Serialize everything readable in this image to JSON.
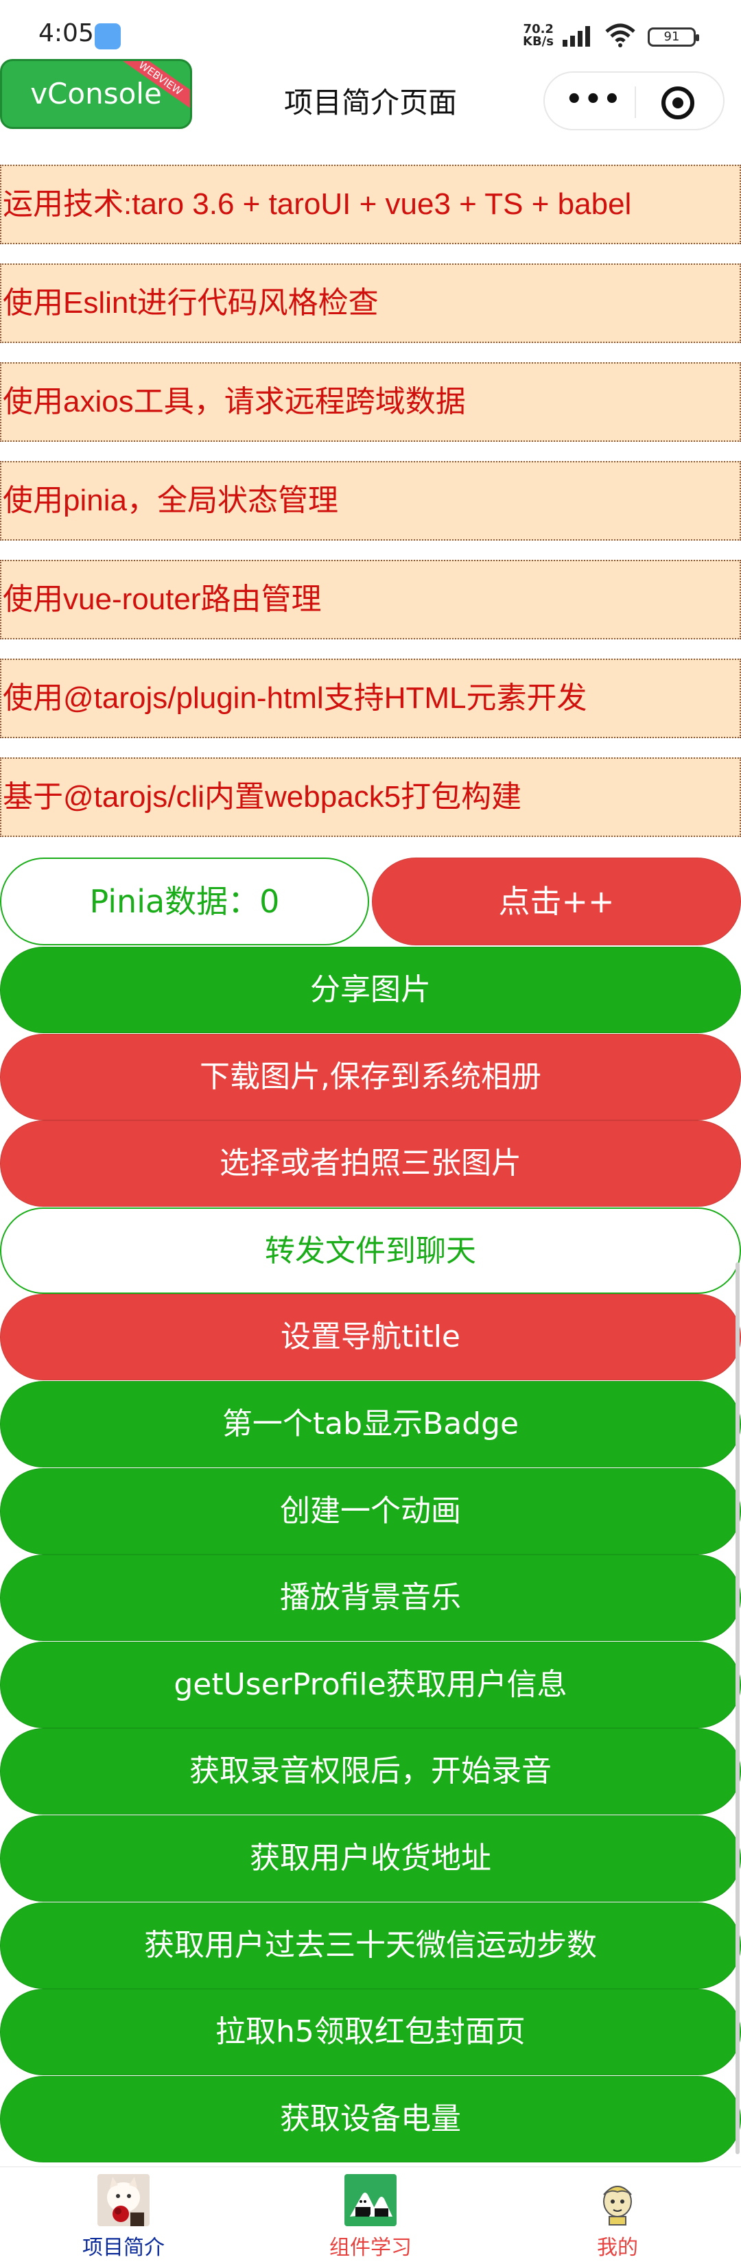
{
  "status_bar": {
    "time": "4:05",
    "speed_value": "70.2",
    "speed_unit": "KB/s",
    "battery": "91"
  },
  "navbar": {
    "vconsole_label": "vConsole",
    "vconsole_ribbon": "WEBVIEW",
    "title": "项目简介页面",
    "more_icon": "more-dots-icon",
    "close_icon": "target-close-icon"
  },
  "info_items": [
    "运用技术:taro 3.6 + taroUI + vue3 + TS + babel",
    "使用Eslint进行代码风格检查",
    "使用axios工具，请求远程跨域数据",
    "使用pinia，全局状态管理",
    "使用vue-router路由管理",
    "使用@tarojs/plugin-html支持HTML元素开发",
    "基于@tarojs/cli内置webpack5打包构建"
  ],
  "pinia": {
    "label": "Pinia数据：0",
    "click_label": "点击++"
  },
  "buttons": [
    {
      "label": "分享图片",
      "style": "green"
    },
    {
      "label": "下载图片,保存到系统相册",
      "style": "red"
    },
    {
      "label": "选择或者拍照三张图片",
      "style": "red"
    },
    {
      "label": "转发文件到聊天",
      "style": "white"
    },
    {
      "label": "设置导航title",
      "style": "red"
    },
    {
      "label": "第一个tab显示Badge",
      "style": "green"
    },
    {
      "label": "创建一个动画",
      "style": "green"
    },
    {
      "label": "播放背景音乐",
      "style": "green"
    },
    {
      "label": "getUserProfile获取用户信息",
      "style": "green"
    },
    {
      "label": "获取录音权限后，开始录音",
      "style": "green"
    },
    {
      "label": "获取用户收货地址",
      "style": "green"
    },
    {
      "label": "获取用户过去三十天微信运动步数",
      "style": "green"
    },
    {
      "label": "拉取h5领取红包封面页",
      "style": "green"
    },
    {
      "label": "获取设备电量",
      "style": "green"
    }
  ],
  "tabbar": {
    "tabs": [
      {
        "label": "项目简介",
        "icon": "cat-with-rose-icon",
        "active": true
      },
      {
        "label": "组件学习",
        "icon": "rice-ball-icon",
        "active": false
      },
      {
        "label": "我的",
        "icon": "cartoon-face-icon",
        "active": false
      }
    ]
  },
  "colors": {
    "green": "#1aad19",
    "red": "#e64340",
    "info_bg": "#ffe4c4",
    "info_text": "#d0100c",
    "active_tab": "#0a2a9a"
  }
}
